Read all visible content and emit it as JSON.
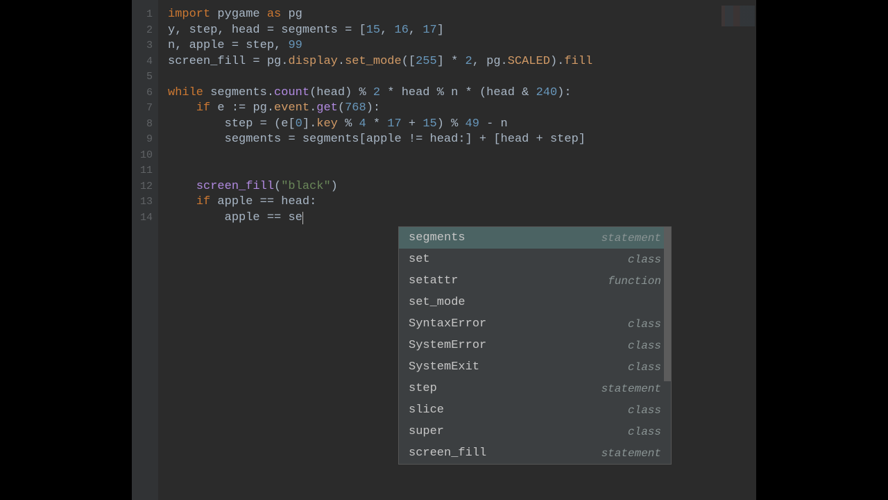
{
  "lines": [
    {
      "n": "1"
    },
    {
      "n": "2"
    },
    {
      "n": "3"
    },
    {
      "n": "4"
    },
    {
      "n": "5"
    },
    {
      "n": "6"
    },
    {
      "n": "7"
    },
    {
      "n": "8"
    },
    {
      "n": "9"
    },
    {
      "n": "10"
    },
    {
      "n": "11"
    },
    {
      "n": "12"
    },
    {
      "n": "13"
    },
    {
      "n": "14"
    }
  ],
  "code": {
    "l1": {
      "import": "import",
      "pygame": "pygame",
      "as": "as",
      "pg": "pg"
    },
    "l2": {
      "y": "y",
      "c1": ", ",
      "step": "step",
      "c2": ", ",
      "head": "head",
      "eq1": " = ",
      "segments": "segments",
      "eq2": " = ",
      "lb": "[",
      "n1": "15",
      "c3": ", ",
      "n2": "16",
      "c4": ", ",
      "n3": "17",
      "rb": "]"
    },
    "l3": {
      "n": "n",
      "c1": ", ",
      "apple": "apple",
      "eq": " = ",
      "step": "step",
      "c2": ", ",
      "num": "99"
    },
    "l4": {
      "sf": "screen_fill",
      "eq": " = ",
      "pg": "pg",
      "d1": ".",
      "display": "display",
      "d2": ".",
      "set_mode": "set_mode",
      "lp": "(",
      "lb": "[",
      "n1": "255",
      "rb": "]",
      "mul": " * ",
      "n2": "2",
      "c": ", ",
      "pg2": "pg",
      "d3": ".",
      "scaled": "SCALED",
      "rp": ")",
      "d4": ".",
      "fill": "fill"
    },
    "l6": {
      "while": "while",
      "sp": " ",
      "segments": "segments",
      "d": ".",
      "count": "count",
      "lp": "(",
      "head": "head",
      "rp": ")",
      "mod": " % ",
      "n2": "2",
      "mul": " * ",
      "head2": "head",
      "mod2": " % ",
      "nn": "n",
      "mul2": " * ",
      "lp2": "(",
      "head3": "head",
      "amp": " & ",
      "n240": "240",
      "rp2": "):"
    },
    "l7": {
      "indent": "    ",
      "if": "if",
      "sp": " ",
      "e": "e",
      "wal": " := ",
      "pg": "pg",
      "d1": ".",
      "event": "event",
      "d2": ".",
      "get": "get",
      "lp": "(",
      "n": "768",
      "rp": "):"
    },
    "l8": {
      "indent": "        ",
      "step": "step",
      "eq": " = ",
      "lp": "(",
      "e": "e",
      "lb": "[",
      "z": "0",
      "rb": "]",
      "d": ".",
      "key": "key",
      "mod": " % ",
      "n4": "4",
      "mul": " * ",
      "n17": "17",
      "plus": " + ",
      "n15": "15",
      "rp": ")",
      "mod2": " % ",
      "n49": "49",
      "minus": " - ",
      "nn": "n"
    },
    "l9": {
      "indent": "        ",
      "segments": "segments",
      "eq": " = ",
      "segments2": "segments",
      "lb": "[",
      "apple": "apple",
      "ne": " != ",
      "head": "head",
      "col": ":",
      "rb": "]",
      "plus": " + ",
      "lb2": "[",
      "head2": "head",
      "plus2": " + ",
      "step": "step",
      "rb2": "]"
    },
    "l12": {
      "indent": "    ",
      "sf": "screen_fill",
      "lp": "(",
      "str": "\"black\"",
      "rp": ")"
    },
    "l13": {
      "indent": "    ",
      "if": "if",
      "sp": " ",
      "apple": "apple",
      "eq": " == ",
      "head": "head",
      "col": ":"
    },
    "l14": {
      "indent": "        ",
      "apple": "apple",
      "eq": " == ",
      "se": "se"
    }
  },
  "autocomplete": {
    "items": [
      {
        "name": "segments",
        "kind": "statement",
        "selected": true
      },
      {
        "name": "set",
        "kind": "class"
      },
      {
        "name": "setattr",
        "kind": "function"
      },
      {
        "name": "set_mode",
        "kind": ""
      },
      {
        "name": "SyntaxError",
        "kind": "class"
      },
      {
        "name": "SystemError",
        "kind": "class"
      },
      {
        "name": "SystemExit",
        "kind": "class"
      },
      {
        "name": "step",
        "kind": "statement"
      },
      {
        "name": "slice",
        "kind": "class"
      },
      {
        "name": "super",
        "kind": "class"
      },
      {
        "name": "screen_fill",
        "kind": "statement"
      }
    ]
  }
}
